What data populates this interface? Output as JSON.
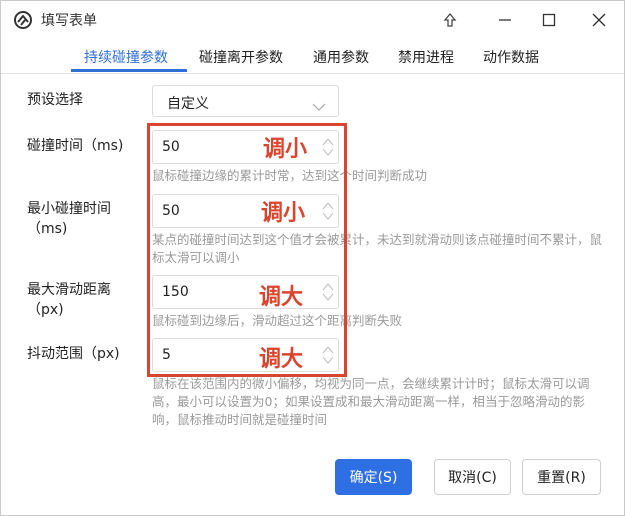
{
  "window": {
    "title": "填写表单"
  },
  "tabs": [
    {
      "label": "持续碰撞参数",
      "active": true
    },
    {
      "label": "碰撞离开参数",
      "active": false
    },
    {
      "label": "通用参数",
      "active": false
    },
    {
      "label": "禁用进程",
      "active": false
    },
    {
      "label": "动作数据",
      "active": false
    }
  ],
  "form": {
    "preset": {
      "label": "预设选择",
      "value": "自定义"
    },
    "collision_time": {
      "label": "碰撞时间（ms)",
      "value": "50",
      "hint": "鼠标碰撞边缘的累计时常，达到这个时间判断成功"
    },
    "min_collision_time": {
      "label_line1": "最小碰撞时间",
      "label_line2": "（ms)",
      "value": "50",
      "hint": "某点的碰撞时间达到这个值才会被累计，未达到就滑动则该点碰撞时间不累计，鼠标太滑可以调小"
    },
    "max_slide_distance": {
      "label_line1": "最大滑动距离",
      "label_line2": "（px)",
      "value": "150",
      "hint": "鼠标碰到边缘后，滑动超过这个距离判断失败"
    },
    "jitter_range": {
      "label": "抖动范围（px)",
      "value": "5",
      "hint": "鼠标在该范围内的微小偏移，均视为同一点，会继续累计计时；鼠标太滑可以调高，最小可以设置为0；如果设置成和最大滑动距离一样，相当于忽略滑动的影响，鼠标推动时间就是碰撞时间"
    }
  },
  "annotations": {
    "a1": "调小",
    "a2": "调小",
    "a3": "调大",
    "a4": "调大",
    "color": "#d9452f"
  },
  "buttons": {
    "ok": "确定(S)",
    "cancel": "取消(C)",
    "reset": "重置(R)"
  },
  "colors": {
    "accent": "#2f6fd6",
    "primary_button": "#2f6fe4"
  }
}
